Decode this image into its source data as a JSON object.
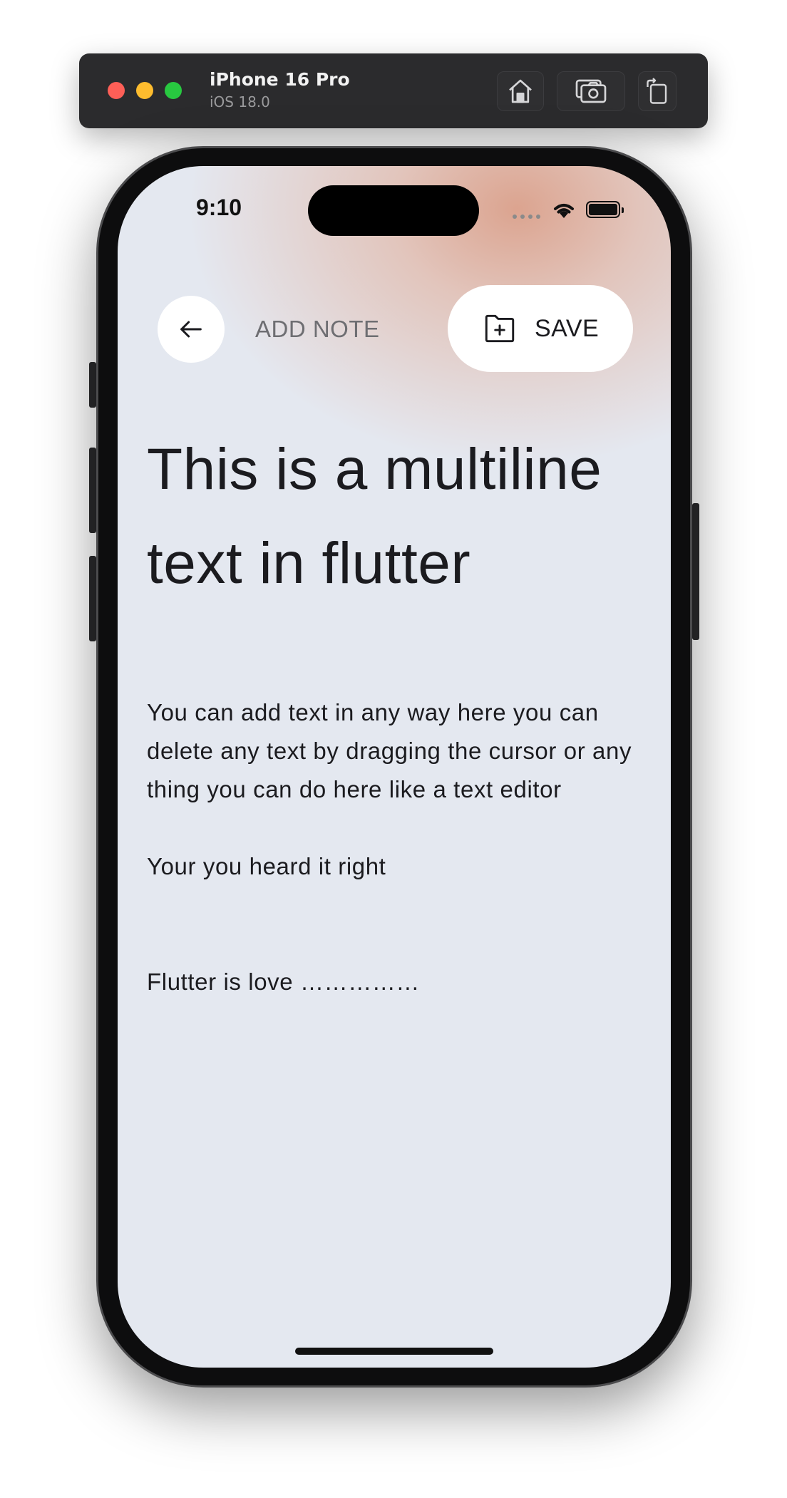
{
  "simulator": {
    "device_name": "iPhone 16 Pro",
    "os_version": "iOS 18.0",
    "buttons": [
      "home-icon",
      "screenshot-icon",
      "rotate-icon"
    ]
  },
  "status_bar": {
    "time": "9:10"
  },
  "header": {
    "back_icon": "arrow-left-icon",
    "title": "ADD NOTE",
    "save_icon": "folder-add-icon",
    "save_label": "SAVE"
  },
  "note": {
    "title": "This is a multiline text in flutter",
    "body": "You can add text in any way here you can delete any text by dragging the cursor or any thing you can do here like a text editor\n\nYour you heard it right\n\n\nFlutter is love ……………"
  },
  "colors": {
    "background": "#e4e8f0",
    "accent_glow": "#dba08a",
    "text": "#1b1b1f",
    "muted_text": "#6e6e72"
  }
}
